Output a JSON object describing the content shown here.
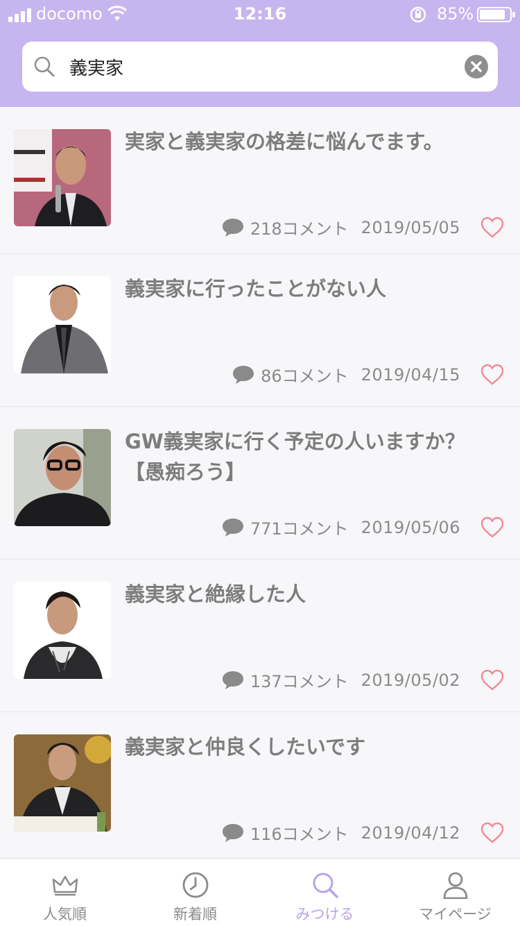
{
  "status_bar": {
    "carrier": "docomo",
    "time": "12:16",
    "battery": "85%"
  },
  "search": {
    "query": "義実家",
    "placeholder": ""
  },
  "items": [
    {
      "title": "実家と義実家の格差に悩んでます。",
      "comments": "218コメント",
      "date": "2019/05/05"
    },
    {
      "title": "義実家に行ったことがない人",
      "comments": "86コメント",
      "date": "2019/04/15"
    },
    {
      "title": "GW義実家に行く予定の人いますか？【愚痴ろう】",
      "comments": "771コメント",
      "date": "2019/05/06"
    },
    {
      "title": "義実家と絶縁した人",
      "comments": "137コメント",
      "date": "2019/05/02"
    },
    {
      "title": "義実家と仲良くしたいです",
      "comments": "116コメント",
      "date": "2019/04/12"
    }
  ],
  "tabs": [
    {
      "label": "人気順",
      "icon": "crown-icon"
    },
    {
      "label": "新着順",
      "icon": "clock-icon"
    },
    {
      "label": "みつける",
      "icon": "search-icon"
    },
    {
      "label": "マイページ",
      "icon": "user-icon"
    }
  ],
  "colors": {
    "header": "#c7b5ef",
    "active_tab": "#b9a4ea",
    "heart": "#f08a95"
  }
}
